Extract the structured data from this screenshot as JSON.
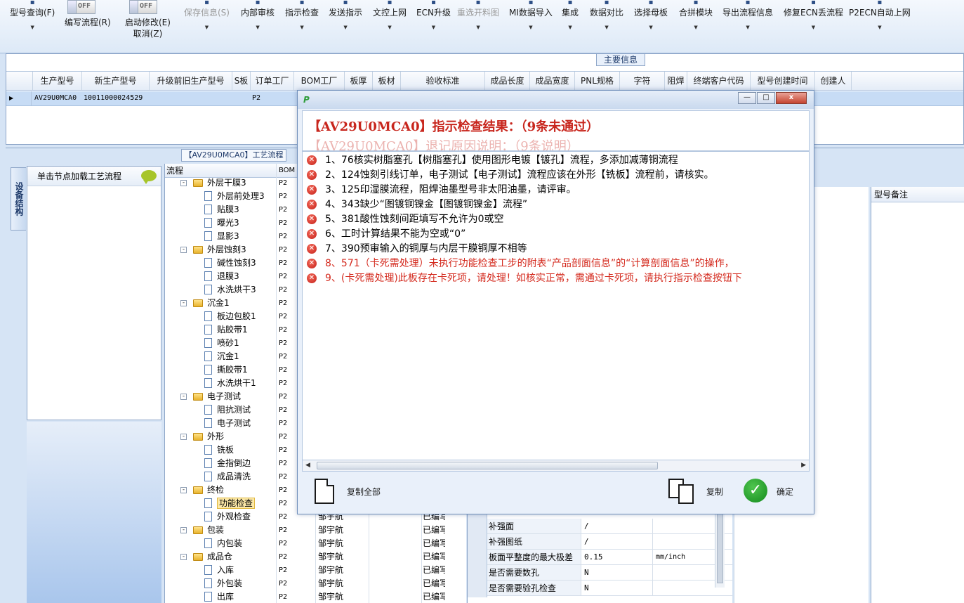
{
  "toolbar": {
    "items": [
      {
        "label": "型号查询(F)",
        "icon": "search-icon"
      },
      {
        "label": "编写流程(R)",
        "toggle": "OFF"
      },
      {
        "label": "启动修改(E)",
        "label2": "取消(Z)",
        "toggle": "OFF"
      },
      {
        "label": "保存信息(S)",
        "disabled": true
      },
      {
        "label": "内部审核"
      },
      {
        "label": "指示检查"
      },
      {
        "label": "发送指示"
      },
      {
        "label": "文控上网"
      },
      {
        "label": "ECN升级"
      },
      {
        "label": "重选开料图",
        "disabled": true
      },
      {
        "label": "MI数据导入"
      },
      {
        "label": "集成"
      },
      {
        "label": "数据对比"
      },
      {
        "label": "选择母板"
      },
      {
        "label": "合拼模块"
      },
      {
        "label": "导出流程信息"
      },
      {
        "label": "修复ECN丢流程"
      },
      {
        "label": "P2ECN自动上网"
      }
    ]
  },
  "main_info": {
    "tab_label": "主要信息",
    "columns": [
      "生产型号",
      "新生产型号",
      "升级前旧生产型号",
      "S板",
      "订单工厂",
      "BOM工厂",
      "板厚",
      "板材",
      "验收标准",
      "成品长度",
      "成品宽度",
      "PNL规格",
      "字符",
      "阻焊",
      "终端客户代码",
      "型号创建时间",
      "创建人"
    ],
    "row": {
      "model": "AV29U0MCA0",
      "new_model": "10011000024529",
      "factory": "P2"
    }
  },
  "side_tab": "设备结构",
  "left_panel": {
    "header": "单击节点加载工艺流程"
  },
  "process_tab": "【AV29U0MCA0】工艺流程",
  "tree": {
    "col_flow": "流程",
    "col_bom": "BOM",
    "rows": [
      {
        "level": 0,
        "type": "folder",
        "name": "外层干膜3",
        "bom": "P2"
      },
      {
        "level": 1,
        "type": "doc",
        "name": "外层前处理3",
        "bom": "P2"
      },
      {
        "level": 1,
        "type": "doc",
        "name": "贴膜3",
        "bom": "P2"
      },
      {
        "level": 1,
        "type": "doc",
        "name": "曝光3",
        "bom": "P2"
      },
      {
        "level": 1,
        "type": "doc",
        "name": "显影3",
        "bom": "P2"
      },
      {
        "level": 0,
        "type": "folder",
        "name": "外层蚀刻3",
        "bom": "P2"
      },
      {
        "level": 1,
        "type": "doc",
        "name": "碱性蚀刻3",
        "bom": "P2"
      },
      {
        "level": 1,
        "type": "doc",
        "name": "退膜3",
        "bom": "P2"
      },
      {
        "level": 1,
        "type": "doc",
        "name": "水洗烘干3",
        "bom": "P2"
      },
      {
        "level": 0,
        "type": "folder",
        "name": "沉金1",
        "bom": "P2"
      },
      {
        "level": 1,
        "type": "doc",
        "name": "板边包胶1",
        "bom": "P2"
      },
      {
        "level": 1,
        "type": "doc",
        "name": "贴胶带1",
        "bom": "P2"
      },
      {
        "level": 1,
        "type": "doc",
        "name": "喷砂1",
        "bom": "P2"
      },
      {
        "level": 1,
        "type": "doc",
        "name": "沉金1",
        "bom": "P2"
      },
      {
        "level": 1,
        "type": "doc",
        "name": "撕胶带1",
        "bom": "P2"
      },
      {
        "level": 1,
        "type": "doc",
        "name": "水洗烘干1",
        "bom": "P2"
      },
      {
        "level": 0,
        "type": "folder",
        "name": "电子测试",
        "bom": "P2"
      },
      {
        "level": 1,
        "type": "doc",
        "name": "阻抗测试",
        "bom": "P2"
      },
      {
        "level": 1,
        "type": "doc",
        "name": "电子测试",
        "bom": "P2"
      },
      {
        "level": 0,
        "type": "folder",
        "name": "外形",
        "bom": "P2"
      },
      {
        "level": 1,
        "type": "doc",
        "name": "铣板",
        "bom": "P2"
      },
      {
        "level": 1,
        "type": "doc",
        "name": "金指倒边",
        "bom": "P2"
      },
      {
        "level": 1,
        "type": "doc",
        "name": "成品清洗",
        "bom": "P2"
      },
      {
        "level": 0,
        "type": "folder",
        "name": "终检",
        "bom": "P2"
      },
      {
        "level": 1,
        "type": "doc",
        "name": "功能检查",
        "bom": "P2",
        "selected": true
      },
      {
        "level": 1,
        "type": "doc",
        "name": "外观检查",
        "bom": "P2",
        "who": "邹宇航",
        "status": "已编写"
      },
      {
        "level": 0,
        "type": "folder",
        "name": "包装",
        "bom": "P2",
        "who": "邹宇航",
        "status": "已编写"
      },
      {
        "level": 1,
        "type": "doc",
        "name": "内包装",
        "bom": "P2",
        "who": "邹宇航",
        "status": "已编写"
      },
      {
        "level": 0,
        "type": "folder",
        "name": "成品仓",
        "bom": "P2",
        "who": "邹宇航",
        "status": "已编写"
      },
      {
        "level": 1,
        "type": "doc",
        "name": "入库",
        "bom": "P2",
        "who": "邹宇航",
        "status": "已编写"
      },
      {
        "level": 1,
        "type": "doc",
        "name": "外包装",
        "bom": "P2",
        "who": "邹宇航",
        "status": "已编写"
      },
      {
        "level": 1,
        "type": "doc",
        "name": "出库",
        "bom": "P2",
        "who": "邹宇航",
        "status": "已编写"
      }
    ]
  },
  "right_panel": {
    "header": "型号备注"
  },
  "attributes": [
    {
      "key": "补强面",
      "value": "/",
      "unit": ""
    },
    {
      "key": "补强图纸",
      "value": "/",
      "unit": ""
    },
    {
      "key": "板面平整度的最大极差",
      "value": "0.15",
      "unit": "mm/inch"
    },
    {
      "key": "是否需要数孔",
      "value": "N",
      "unit": ""
    },
    {
      "key": "是否需要验孔检查",
      "value": "N",
      "unit": ""
    }
  ],
  "dialog": {
    "title_main": "【AV29U0MCA0】指示检查结果：（9条未通过）",
    "title_ghost": "【AV29U0MCA0】退记原因说明：（9条说明）",
    "messages": [
      {
        "text": "1、76核实树脂塞孔【树脂塞孔】使用图形电镀【镀孔】流程，多添加减薄铜流程",
        "red": false
      },
      {
        "text": "2、124蚀刻引线订单，电子测试【电子测试】流程应该在外形【铣板】流程前，请核实。",
        "red": false
      },
      {
        "text": "3、125印湿膜流程，阻焊油墨型号非太阳油墨，请评审。",
        "red": false
      },
      {
        "text": "4、343缺少“图镀铜镍金【图镀铜镍金】流程”",
        "red": false
      },
      {
        "text": "5、381酸性蚀刻间距填写不允许为0或空",
        "red": false
      },
      {
        "text": "6、工时计算结果不能为空或“0”",
        "red": false
      },
      {
        "text": "7、390预审输入的铜厚与内层干膜铜厚不相等",
        "red": false
      },
      {
        "text": "8、571（卡死需处理）未执行功能检查工步的附表“产品剖面信息”的“计算剖面信息”的操作，",
        "red": true
      },
      {
        "text": "9、(卡死需处理)此板存在卡死项，请处理！如核实正常，需通过卡死项，请执行指示检查按钮下",
        "red": true
      }
    ],
    "copy_all_label": "复制全部",
    "copy_label": "复制",
    "ok_label": "确定",
    "btn_min": "—",
    "btn_max": "□",
    "btn_close": "x",
    "logo": "P"
  }
}
